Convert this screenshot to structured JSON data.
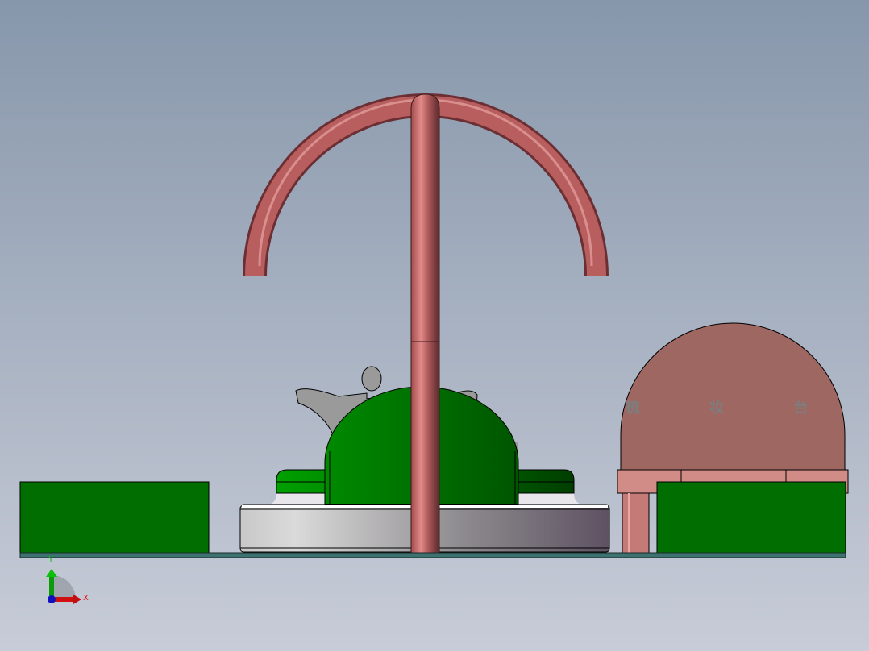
{
  "model": {
    "dresser_label": "梳 妆 台",
    "colors": {
      "background_top": "#8797ab",
      "background_bottom": "#c8ccd8",
      "green": "#006e00",
      "tube": "#b85a5a",
      "dresser": "#9e6762",
      "plate": "#3d7270"
    }
  },
  "triad": {
    "x_label": "X",
    "y_label": "Y"
  }
}
